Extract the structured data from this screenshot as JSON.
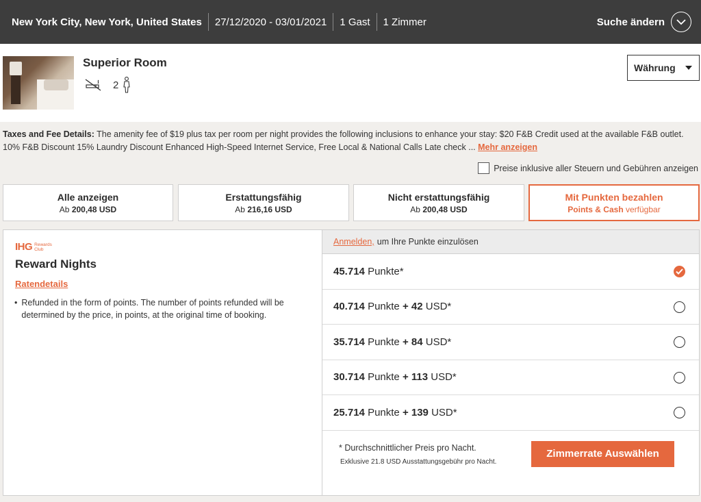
{
  "search": {
    "location": "New York City, New York, United States",
    "dates": "27/12/2020 - 03/01/2021",
    "guests": "1 Gast",
    "rooms": "1 Zimmer",
    "change_label": "Suche ändern"
  },
  "room": {
    "title": "Superior Room",
    "guest_count": "2",
    "currency_label": "Währung"
  },
  "taxes": {
    "label": "Taxes and Fee Details:",
    "text": "The amenity fee of $19 plus tax per room per night provides the following inclusions to enhance your stay: $20 F&B Credit used at the available F&B outlet. 10% F&B Discount 15% Laundry Discount Enhanced High-Speed Internet Service, Free Local & National Calls Late check ...",
    "more_label": "Mehr anzeigen",
    "incl_label": "Preise inklusive aller Steuern und Gebühren anzeigen"
  },
  "tabs": [
    {
      "title": "Alle anzeigen",
      "prefix": "Ab",
      "price": "200,48 USD"
    },
    {
      "title": "Erstattungsfähig",
      "prefix": "Ab",
      "price": "216,16 USD"
    },
    {
      "title": "Nicht erstattungsfähig",
      "prefix": "Ab",
      "price": "200,48 USD"
    },
    {
      "title": "Mit Punkten bezahlen",
      "prefix": "Points & Cash",
      "price": "verfügbar"
    }
  ],
  "rate": {
    "brand": "IHG",
    "brand_sub_1": "Rewards",
    "brand_sub_2": "Club",
    "title": "Reward Nights",
    "details_label": "Ratendetails",
    "description": "Refunded in the form of points. The number of points refunded will be determined by the price, in points, at the original time of booking."
  },
  "login": {
    "link": "Anmelden,",
    "text": "um Ihre Punkte einzulösen"
  },
  "options": [
    {
      "points": "45.714",
      "unit": "Punkte*",
      "plus": "",
      "cash": "",
      "currency": ""
    },
    {
      "points": "40.714",
      "unit": "Punkte",
      "plus": "+ 42",
      "cash": "",
      "currency": "USD*"
    },
    {
      "points": "35.714",
      "unit": "Punkte",
      "plus": "+ 84",
      "cash": "",
      "currency": "USD*"
    },
    {
      "points": "30.714",
      "unit": "Punkte",
      "plus": "+ 113",
      "cash": "",
      "currency": "USD*"
    },
    {
      "points": "25.714",
      "unit": "Punkte",
      "plus": "+ 139",
      "cash": "",
      "currency": "USD*"
    }
  ],
  "footer": {
    "note1": "*  Durchschnittlicher Preis pro Nacht.",
    "note2": "Exklusive 21.8 USD Ausstattungsgebühr pro Nacht.",
    "select_label": "Zimmerrate Auswählen"
  },
  "colors": {
    "accent": "#e5683e",
    "header_bg": "#3d3d3d"
  }
}
